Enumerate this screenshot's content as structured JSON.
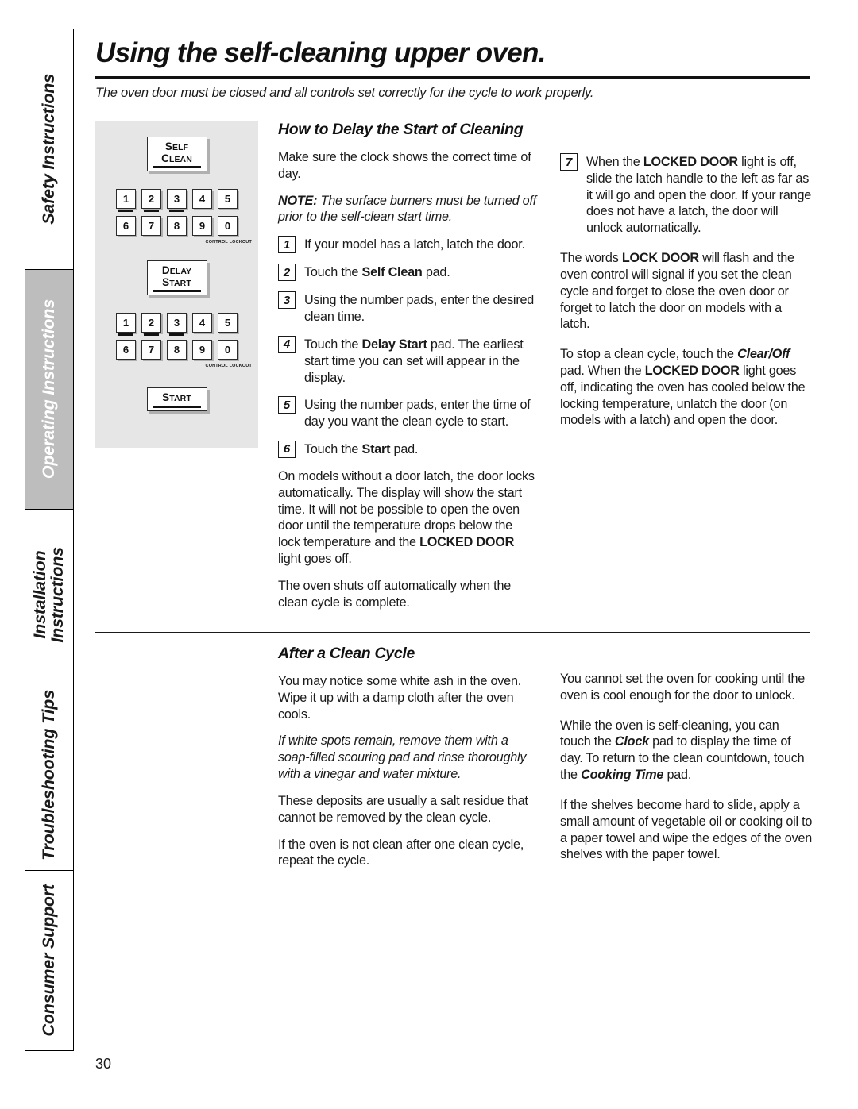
{
  "sidebar": {
    "tabs": [
      {
        "label": "Safety Instructions",
        "active": false,
        "flex": 24
      },
      {
        "label": "Operating Instructions",
        "active": true,
        "flex": 24
      },
      {
        "label": "Installation\nInstructions",
        "active": false,
        "flex": 17
      },
      {
        "label": "Troubleshooting Tips",
        "active": false,
        "flex": 19
      },
      {
        "label": "Consumer Support",
        "active": false,
        "flex": 18
      }
    ]
  },
  "header": {
    "title": "Using the self-cleaning upper oven.",
    "subtitle": "The oven door must be closed and all controls set correctly for the cycle to work properly."
  },
  "diagram": {
    "self_clean_line1": "S",
    "self_clean_line1_rest": "ELF",
    "self_clean_line2": "C",
    "self_clean_line2_rest": "LEAN",
    "delay_start_line1": "D",
    "delay_start_line1_rest": "ELAY",
    "delay_start_line2": "S",
    "delay_start_line2_rest": "TART",
    "start_cap": "S",
    "start_rest": "TART",
    "keys_row1": [
      "1",
      "2",
      "3",
      "4",
      "5"
    ],
    "keys_row2": [
      "6",
      "7",
      "8",
      "9",
      "0"
    ],
    "lockout_label": "CONTROL LOCKOUT"
  },
  "section_delay": {
    "heading": "How to Delay the Start of Cleaning",
    "intro": "Make sure the clock shows the correct time of day.",
    "note_label": "NOTE:",
    "note_text": " The surface burners must be turned off prior to the self-clean start time.",
    "steps": [
      {
        "num": "1",
        "text": "If your model has a latch, latch the door."
      },
      {
        "num": "2",
        "text": "Touch the ",
        "bold": "Self Clean",
        "tail": " pad."
      },
      {
        "num": "3",
        "text": "Using the number pads, enter the desired clean time."
      },
      {
        "num": "4",
        "text": "Touch the ",
        "bold": "Delay Start",
        "tail": " pad. The earliest start time you can set will appear in the display."
      },
      {
        "num": "5",
        "text": "Using the number pads, enter the time of day you want the clean cycle to start."
      },
      {
        "num": "6",
        "text": "Touch the ",
        "bold": "Start",
        "tail": " pad."
      }
    ],
    "after_steps_1a": "On models without a door latch, the door locks automatically. The display will show the start time. It will not be possible to open the oven door until the temperature drops below the lock temperature and the ",
    "after_steps_1b": "LOCKED DOOR",
    "after_steps_1c": " light goes off.",
    "after_steps_2": "The oven shuts off automatically when the clean cycle is complete.",
    "step7": {
      "num": "7",
      "pre": "When the ",
      "bold": "LOCKED DOOR",
      "post": " light is off, slide the latch handle to the left as far as it will go and open the door. If your range does not have a latch, the door will unlock automatically."
    },
    "right_para_1a": "The words ",
    "right_para_1b": "LOCK DOOR",
    "right_para_1c": " will flash and the oven control will signal if you set the clean cycle and forget to close the oven door or forget to latch the door on models with a latch.",
    "right_para_2a": "To stop a clean cycle, touch the ",
    "right_para_2b": "Clear/Off",
    "right_para_2c": " pad. When the ",
    "right_para_2d": "LOCKED DOOR",
    "right_para_2e": " light goes off, indicating the oven has cooled below the locking temperature, unlatch the door (on models with a latch) and open the door."
  },
  "section_after": {
    "heading": "After a Clean Cycle",
    "left_p1": "You may notice some white ash in the oven. Wipe it up with a damp cloth after the oven cools.",
    "left_p2": "If white spots remain, remove them with a soap-filled scouring pad and rinse thoroughly with a vinegar and water mixture.",
    "left_p3": "These deposits are usually a salt residue that cannot be removed by the clean cycle.",
    "left_p4": "If the oven is not clean after one clean cycle, repeat the cycle.",
    "right_p1": "You cannot set the oven for cooking until the oven is cool enough for the door to unlock.",
    "right_p2a": "While the oven is self-cleaning, you can touch the ",
    "right_p2b": "Clock",
    "right_p2c": " pad to display the time of day. To return to the clean countdown, touch the ",
    "right_p2d": "Cooking Time",
    "right_p2e": " pad.",
    "right_p3": "If the shelves become hard to slide, apply a small amount of vegetable oil or cooking oil to a paper towel and wipe the edges of the oven shelves with the paper towel."
  },
  "footer": {
    "page_number": "30"
  }
}
